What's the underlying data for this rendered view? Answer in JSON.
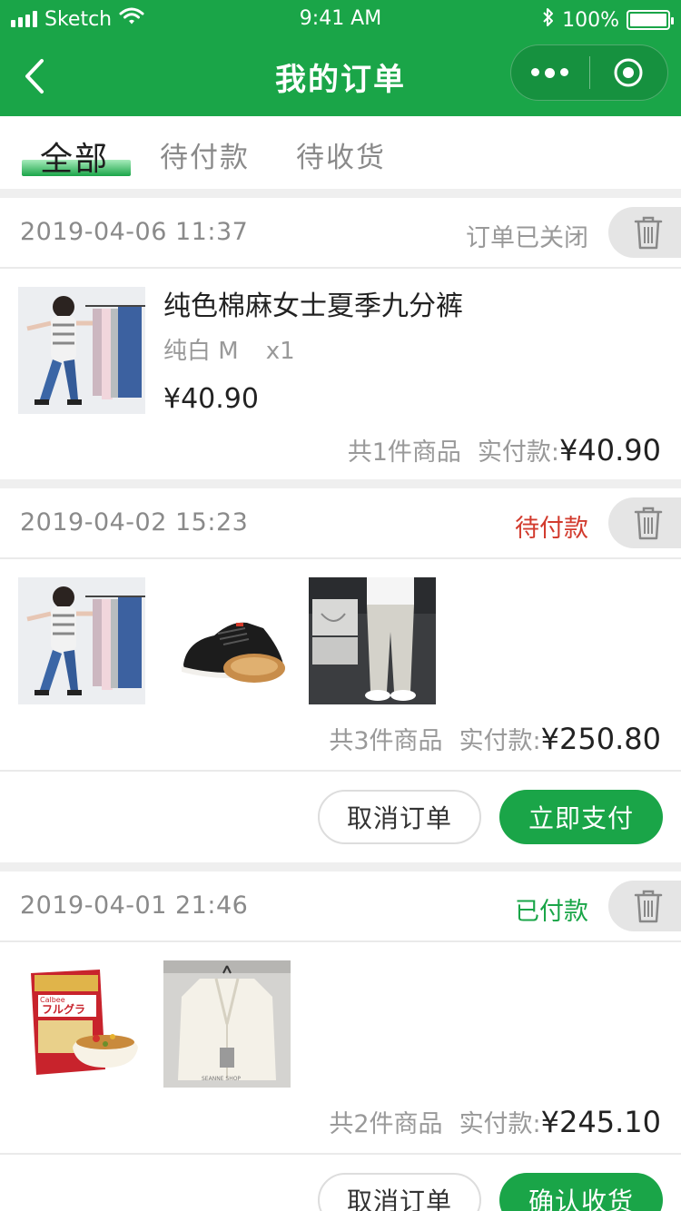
{
  "status_bar": {
    "carrier": "Sketch",
    "time": "9:41 AM",
    "battery": "100%"
  },
  "nav": {
    "title": "我的订单"
  },
  "tabs": [
    {
      "label": "全部"
    },
    {
      "label": "待付款"
    },
    {
      "label": "待收货"
    }
  ],
  "orders": [
    {
      "time": "2019-04-06  11:37",
      "status": "订单已关闭",
      "status_color": "#999999",
      "product": {
        "name": "纯色棉麻女士夏季九分裤",
        "spec": "纯白 M",
        "qty": "x1",
        "price": "¥40.90"
      },
      "count_text": "共1件商品",
      "paid_label": "实付款:",
      "amount": "¥40.90"
    },
    {
      "time": "2019-04-02  15:23",
      "status": "待付款",
      "status_color": "#d23b2e",
      "count_text": "共3件商品",
      "paid_label": "实付款:",
      "amount": "¥250.80",
      "actions": {
        "cancel": "取消订单",
        "pay": "立即支付"
      }
    },
    {
      "time": "2019-04-01  21:46",
      "status": "已付款",
      "status_color": "#1aa548",
      "count_text": "共2件商品",
      "paid_label": "实付款:",
      "amount": "¥245.10",
      "actions": {
        "cancel": "取消订单",
        "confirm": "确认收货"
      }
    }
  ],
  "product_images": {
    "pants_woman": "product-thumb-cropped-pants",
    "shoe": "product-thumb-canvas-shoe",
    "pants_man": "product-thumb-grey-pants",
    "cereal": "product-thumb-granola-bag",
    "jacket": "product-thumb-white-blazer",
    "package_text": "Calbee",
    "package_title": "フルグラ",
    "jacket_tag": "SEANNE SHOP"
  },
  "colors": {
    "brand_green": "#1aa548",
    "pending_red": "#d23b2e"
  }
}
